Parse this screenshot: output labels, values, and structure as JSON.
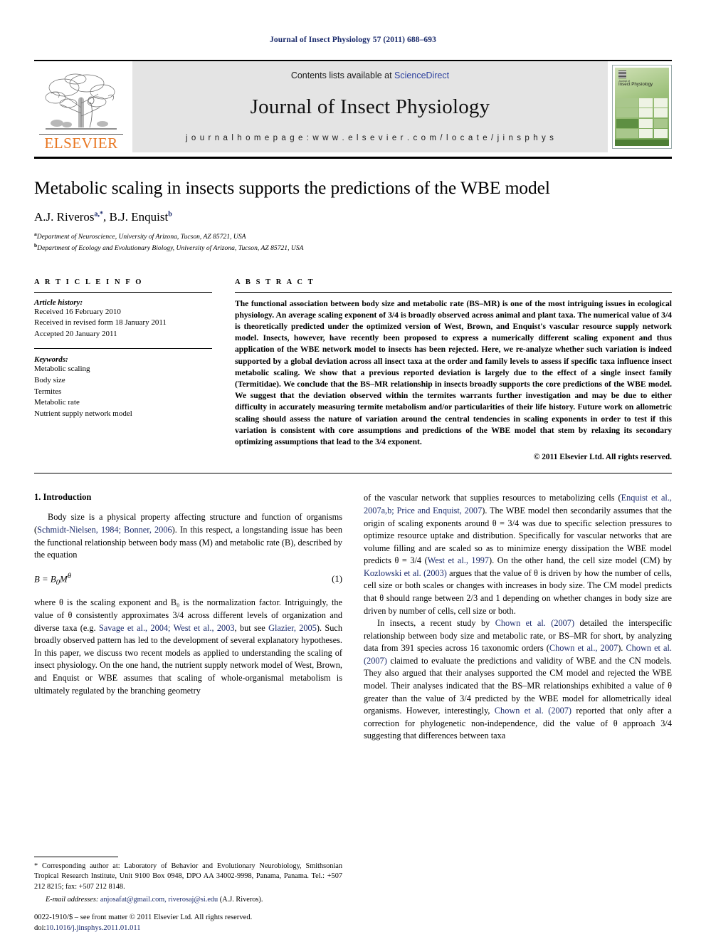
{
  "running_head": "Journal of Insect Physiology 57 (2011) 688–693",
  "masthead": {
    "contents_prefix": "Contents lists available at ",
    "sciencedirect": "ScienceDirect",
    "journal_title": "Journal of Insect Physiology",
    "homepage": "j o u r n a l   h o m e p a g e :   w w w . e l s e v i e r . c o m / l o c a t e / j i n s p h y s",
    "publisher": "ELSEVIER",
    "cover": {
      "label_small": "Journal of",
      "label_name": "Insect Physiology"
    }
  },
  "article": {
    "title": "Metabolic scaling in insects supports the predictions of the WBE model",
    "authors": "A.J. Riveros, B.J. Enquist",
    "author_parts": [
      {
        "name": "A.J. Riveros",
        "sup": "a,*"
      },
      {
        "name": "B.J. Enquist",
        "sup": "b"
      }
    ],
    "affiliations": [
      {
        "sup": "a",
        "text": "Department of Neuroscience, University of Arizona, Tucson, AZ 85721, USA"
      },
      {
        "sup": "b",
        "text": "Department of Ecology and Evolutionary Biology, University of Arizona, Tucson, AZ 85721, USA"
      }
    ]
  },
  "article_info": {
    "label": "A R T I C L E   I N F O",
    "history_label": "Article history:",
    "history": [
      "Received 16 February 2010",
      "Received in revised form 18 January 2011",
      "Accepted 20 January 2011"
    ],
    "keywords_label": "Keywords:",
    "keywords": [
      "Metabolic scaling",
      "Body size",
      "Termites",
      "Metabolic rate",
      "Nutrient supply network model"
    ]
  },
  "abstract": {
    "label": "A B S T R A C T",
    "text": "The functional association between body size and metabolic rate (BS–MR) is one of the most intriguing issues in ecological physiology. An average scaling exponent of 3/4 is broadly observed across animal and plant taxa. The numerical value of 3/4 is theoretically predicted under the optimized version of West, Brown, and Enquist's vascular resource supply network model. Insects, however, have recently been proposed to express a numerically different scaling exponent and thus application of the WBE network model to insects has been rejected. Here, we re-analyze whether such variation is indeed supported by a global deviation across all insect taxa at the order and family levels to assess if specific taxa influence insect metabolic scaling. We show that a previous reported deviation is largely due to the effect of a single insect family (Termitidae). We conclude that the BS–MR relationship in insects broadly supports the core predictions of the WBE model. We suggest that the deviation observed within the termites warrants further investigation and may be due to either difficulty in accurately measuring termite metabolism and/or particularities of their life history. Future work on allometric scaling should assess the nature of variation around the central tendencies in scaling exponents in order to test if this variation is consistent with core assumptions and predictions of the WBE model that stem by relaxing its secondary optimizing assumptions that lead to the 3/4 exponent.",
    "copyright": "© 2011 Elsevier Ltd. All rights reserved."
  },
  "introduction": {
    "heading": "1. Introduction",
    "p1_a": "Body size is a physical property affecting structure and function of organisms (",
    "p1_cit1": "Schmidt-Nielsen, 1984; Bonner, 2006",
    "p1_b": "). In this respect, a longstanding issue has been the functional relationship between body mass (M) and metabolic rate (B), described by the equation",
    "equation": "B = B₀M^θ",
    "equation_number": "(1)",
    "p2_a": "where θ is the scaling exponent and B₀ is the normalization factor. Intriguingly, the value of θ consistently approximates 3/4 across different levels of organization and diverse taxa (e.g. ",
    "p2_cit1": "Savage et al., 2004; West et al., 2003",
    "p2_mid": ", but see ",
    "p2_cit2": "Glazier, 2005",
    "p2_b": "). Such broadly observed pattern has led to the development of several explanatory hypotheses. In this paper, we discuss two recent models as applied to understanding the scaling of insect physiology. On the one hand, the nutrient supply network model of West, Brown, and Enquist or WBE assumes that scaling of whole-organismal metabolism is ultimately regulated by the branching geometry",
    "r1_a": "of the vascular network that supplies resources to metabolizing cells (",
    "r1_cit1": "Enquist et al., 2007a,b; Price and Enquist, 2007",
    "r1_b": "). The WBE model then secondarily assumes that the origin of scaling exponents around θ = 3/4 was due to specific selection pressures to optimize resource uptake and distribution. Specifically for vascular networks that are volume filling and are scaled so as to minimize energy dissipation the WBE model predicts θ = 3/4 (",
    "r1_cit2": "West et al., 1997",
    "r1_c": "). On the other hand, the cell size model (CM) by ",
    "r1_cit3": "Kozlowski et al. (2003)",
    "r1_d": " argues that the value of θ is driven by how the number of cells, cell size or both scales or changes with increases in body size. The CM model predicts that θ should range between 2/3 and 1 depending on whether changes in body size are driven by number of cells, cell size or both.",
    "r2_a": "In insects, a recent study by ",
    "r2_cit1": "Chown et al. (2007)",
    "r2_b": " detailed the interspecific relationship between body size and metabolic rate, or BS–MR for short, by analyzing data from 391 species across 16 taxonomic orders (",
    "r2_cit2": "Chown et al., 2007",
    "r2_c": "). ",
    "r2_cit3": "Chown et al. (2007)",
    "r2_d": " claimed to evaluate the predictions and validity of WBE and the CN models. They also argued that their analyses supported the CM model and rejected the WBE model. Their analyses indicated that the BS–MR relationships exhibited a value of θ greater than the value of 3/4 predicted by the WBE model for allometrically ideal organisms. However, interestingly, ",
    "r2_cit4": "Chown et al. (2007)",
    "r2_e": " reported that only after a correction for phylogenetic non-independence, did the value of θ approach 3/4 suggesting that differences between taxa"
  },
  "footnote": {
    "text": "* Corresponding author at: Laboratory of Behavior and Evolutionary Neurobiology, Smithsonian Tropical Research Institute, Unit 9100 Box 0948, DPO AA 34002-9998, Panama, Panama. Tel.: +507 212 8215; fax: +507 212 8148.",
    "email_label": "E-mail addresses:",
    "emails": "anjosafat@gmail.com, riverosaj@si.edu",
    "email_suffix": " (A.J. Riveros)."
  },
  "footer": {
    "issn_line": "0022-1910/$ – see front matter © 2011 Elsevier Ltd. All rights reserved.",
    "doi_label": "doi:",
    "doi": "10.1016/j.jinsphys.2011.01.011"
  },
  "colors": {
    "link_blue": "#1a2a6b",
    "elsevier_orange": "#E87722",
    "banner_gray": "#e4e4e4"
  }
}
